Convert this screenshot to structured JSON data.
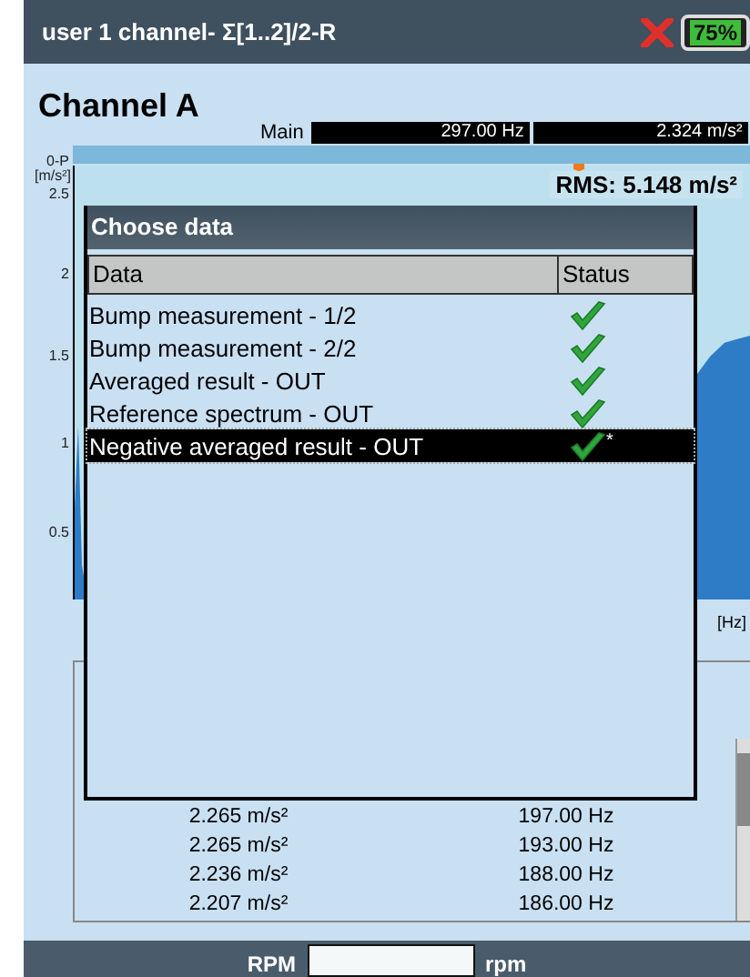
{
  "title_bar": {
    "title": "user 1 channel- Σ[1..2]/2-R",
    "battery": "75%"
  },
  "header": {
    "channel": "Channel A",
    "main_label": "Main",
    "frequency": "297.00 Hz",
    "amplitude": "2.324 m/s²"
  },
  "chart": {
    "y_unit": "0-P",
    "y_unit_2": "[m/s²]",
    "y_ticks": [
      "2.5",
      "2",
      "1.5",
      "1",
      "0.5"
    ],
    "x_unit": "[Hz]",
    "rms": "RMS: 5.148 m/s²"
  },
  "peaks": [
    {
      "amplitude": "2.265 m/s²",
      "frequency": "197.00 Hz"
    },
    {
      "amplitude": "2.265 m/s²",
      "frequency": "193.00 Hz"
    },
    {
      "amplitude": "2.236 m/s²",
      "frequency": "188.00 Hz"
    },
    {
      "amplitude": "2.207 m/s²",
      "frequency": "186.00 Hz"
    }
  ],
  "dialog": {
    "title": "Choose data",
    "columns": [
      "Data",
      "Status"
    ],
    "rows": [
      {
        "label": "Bump measurement - 1/2",
        "ok": true,
        "note": "",
        "selected": false
      },
      {
        "label": "Bump measurement - 2/2",
        "ok": true,
        "note": "",
        "selected": false
      },
      {
        "label": "Averaged result - OUT",
        "ok": true,
        "note": "",
        "selected": false
      },
      {
        "label": "Reference spectrum - OUT",
        "ok": true,
        "note": "",
        "selected": false
      },
      {
        "label": "Negative averaged result - OUT",
        "ok": true,
        "note": "*",
        "selected": true
      }
    ]
  },
  "bottom_bar": {
    "label": "RPM",
    "unit": "rpm"
  }
}
